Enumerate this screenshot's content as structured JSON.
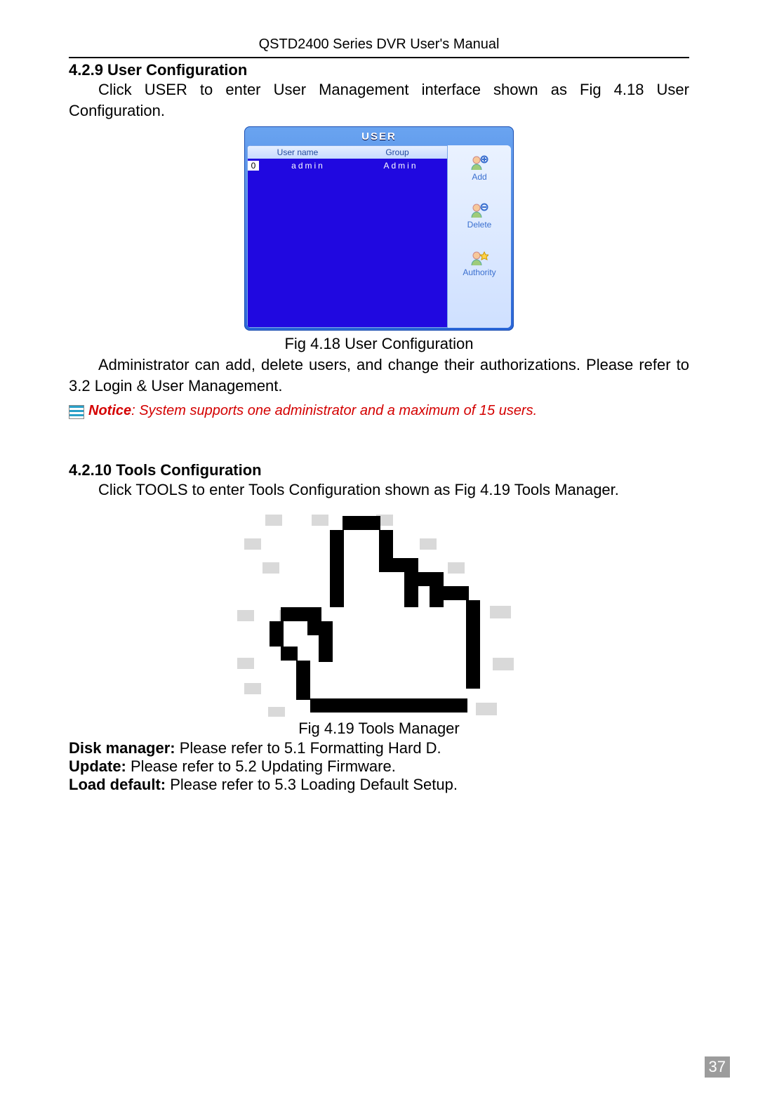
{
  "header": {
    "manual_title": "QSTD2400 Series DVR User's Manual"
  },
  "section_user": {
    "number_title": "4.2.9  User Configuration",
    "intro": "Click USER to enter User Management interface shown as Fig 4.18 User Configuration.",
    "dialog": {
      "title": "USER",
      "columns": {
        "c1": "User name",
        "c2": "Group"
      },
      "row": {
        "idx": "0",
        "user": "admin",
        "group": "Admin"
      },
      "buttons": {
        "add": "Add",
        "delete": "Delete",
        "authority": "Authority"
      }
    },
    "caption": "Fig 4.18 User Configuration",
    "after": "Administrator can add, delete users, and change their authorizations. Please refer to 3.2 Login & User Management.",
    "notice_label": "Notice",
    "notice_rest": ": System supports one administrator and a maximum of 15 users."
  },
  "section_tools": {
    "number_title": "4.2.10  Tools Configuration",
    "intro": "Click TOOLS to enter Tools Configuration shown as Fig 4.19 Tools Manager.",
    "caption": "Fig 4.19 Tools Manager",
    "items": {
      "disk": {
        "label": "Disk manager:",
        "text": " Please refer to 5.1 Formatting Hard D."
      },
      "update": {
        "label": "Update:",
        "text": " Please refer to 5.2 Updating Firmware."
      },
      "load": {
        "label": "Load default:",
        "text": " Please refer to 5.3 Loading Default Setup."
      }
    }
  },
  "page_number": "37"
}
